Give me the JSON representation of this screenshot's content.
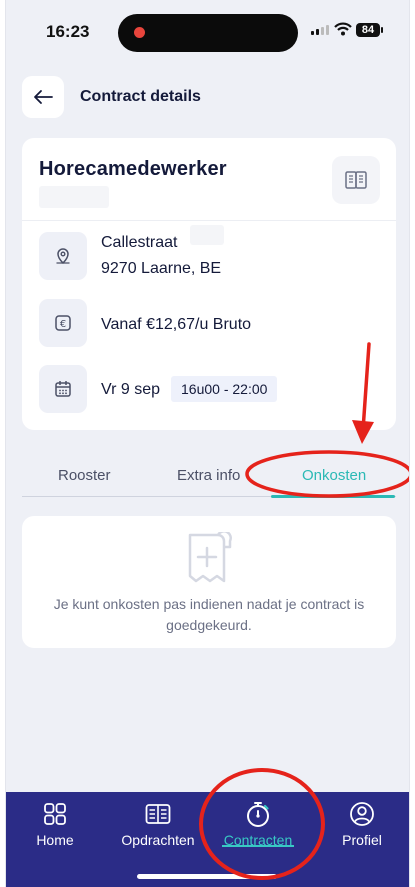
{
  "status_bar": {
    "time": "16:23",
    "battery": "84"
  },
  "header": {
    "title": "Contract details"
  },
  "contract": {
    "title": "Horecamedewerker",
    "address_line1": "Callestraat",
    "address_line2": "9270 Laarne, BE",
    "wage": "Vanaf €12,67/u Bruto",
    "date": "Vr 9 sep",
    "time_range": "16u00 - 22:00"
  },
  "tabs": [
    {
      "label": "Rooster",
      "active": false
    },
    {
      "label": "Extra info",
      "active": false
    },
    {
      "label": "Onkosten",
      "active": true
    }
  ],
  "expenses": {
    "message": "Je kunt onkosten pas indienen nadat je contract is goedgekeurd."
  },
  "bottom_nav": [
    {
      "label": "Home",
      "icon": "grid-icon",
      "active": false
    },
    {
      "label": "Opdrachten",
      "icon": "newspaper-icon",
      "active": false
    },
    {
      "label": "Contracten",
      "icon": "stopwatch-icon",
      "active": true
    },
    {
      "label": "Profiel",
      "icon": "user-circle-icon",
      "active": false
    }
  ],
  "colors": {
    "accent": "#2bb9b5",
    "nav_background": "#2b2c87",
    "annotation": "#e5231b",
    "page_background": "#eef0f6"
  }
}
